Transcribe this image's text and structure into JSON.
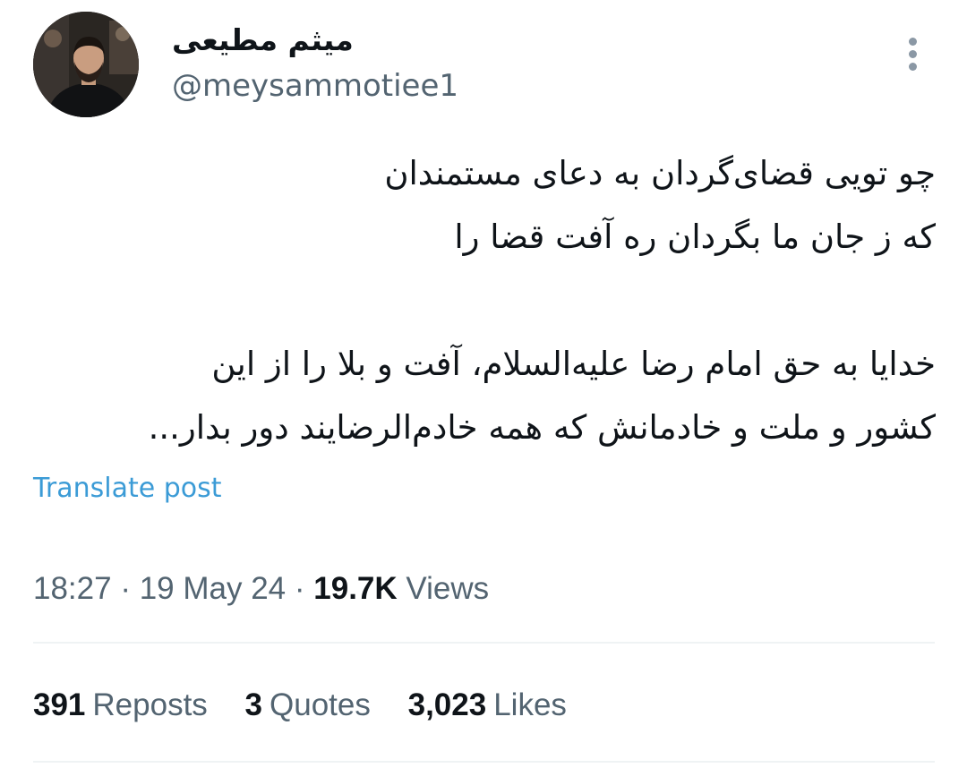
{
  "author": {
    "display_name": "میثم مطیعی",
    "handle": "@meysammotiee1"
  },
  "post": {
    "lines": [
      "چو تویی قضای‌گردان به دعای مستمندان",
      "که ز جان ما بگردان ره آفت قضا را",
      "",
      "خدایا به حق امام رضا علیه‌السلام، آفت و بلا  را از این",
      "کشور و ملت و خادمانش که همه خادم‌الرضایند دور بدار..."
    ],
    "translate_label": "Translate post"
  },
  "meta": {
    "time": "18:27",
    "date": "19 May 24",
    "views_count": "19.7K",
    "views_label": "Views",
    "separator": "·"
  },
  "stats": {
    "reposts": {
      "count": "391",
      "label": "Reposts"
    },
    "quotes": {
      "count": "3",
      "label": "Quotes"
    },
    "likes": {
      "count": "3,023",
      "label": "Likes"
    }
  },
  "icons": {
    "more": "more-vertical-icon"
  }
}
